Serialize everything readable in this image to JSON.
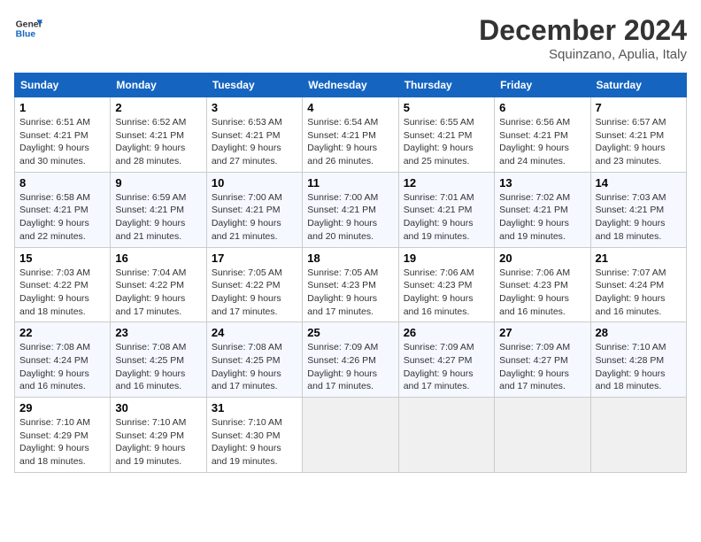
{
  "header": {
    "logo_line1": "General",
    "logo_line2": "Blue",
    "month": "December 2024",
    "location": "Squinzano, Apulia, Italy"
  },
  "weekdays": [
    "Sunday",
    "Monday",
    "Tuesday",
    "Wednesday",
    "Thursday",
    "Friday",
    "Saturday"
  ],
  "weeks": [
    [
      {
        "day": "1",
        "info": "Sunrise: 6:51 AM\nSunset: 4:21 PM\nDaylight: 9 hours and 30 minutes."
      },
      {
        "day": "2",
        "info": "Sunrise: 6:52 AM\nSunset: 4:21 PM\nDaylight: 9 hours and 28 minutes."
      },
      {
        "day": "3",
        "info": "Sunrise: 6:53 AM\nSunset: 4:21 PM\nDaylight: 9 hours and 27 minutes."
      },
      {
        "day": "4",
        "info": "Sunrise: 6:54 AM\nSunset: 4:21 PM\nDaylight: 9 hours and 26 minutes."
      },
      {
        "day": "5",
        "info": "Sunrise: 6:55 AM\nSunset: 4:21 PM\nDaylight: 9 hours and 25 minutes."
      },
      {
        "day": "6",
        "info": "Sunrise: 6:56 AM\nSunset: 4:21 PM\nDaylight: 9 hours and 24 minutes."
      },
      {
        "day": "7",
        "info": "Sunrise: 6:57 AM\nSunset: 4:21 PM\nDaylight: 9 hours and 23 minutes."
      }
    ],
    [
      {
        "day": "8",
        "info": "Sunrise: 6:58 AM\nSunset: 4:21 PM\nDaylight: 9 hours and 22 minutes."
      },
      {
        "day": "9",
        "info": "Sunrise: 6:59 AM\nSunset: 4:21 PM\nDaylight: 9 hours and 21 minutes."
      },
      {
        "day": "10",
        "info": "Sunrise: 7:00 AM\nSunset: 4:21 PM\nDaylight: 9 hours and 21 minutes."
      },
      {
        "day": "11",
        "info": "Sunrise: 7:00 AM\nSunset: 4:21 PM\nDaylight: 9 hours and 20 minutes."
      },
      {
        "day": "12",
        "info": "Sunrise: 7:01 AM\nSunset: 4:21 PM\nDaylight: 9 hours and 19 minutes."
      },
      {
        "day": "13",
        "info": "Sunrise: 7:02 AM\nSunset: 4:21 PM\nDaylight: 9 hours and 19 minutes."
      },
      {
        "day": "14",
        "info": "Sunrise: 7:03 AM\nSunset: 4:21 PM\nDaylight: 9 hours and 18 minutes."
      }
    ],
    [
      {
        "day": "15",
        "info": "Sunrise: 7:03 AM\nSunset: 4:22 PM\nDaylight: 9 hours and 18 minutes."
      },
      {
        "day": "16",
        "info": "Sunrise: 7:04 AM\nSunset: 4:22 PM\nDaylight: 9 hours and 17 minutes."
      },
      {
        "day": "17",
        "info": "Sunrise: 7:05 AM\nSunset: 4:22 PM\nDaylight: 9 hours and 17 minutes."
      },
      {
        "day": "18",
        "info": "Sunrise: 7:05 AM\nSunset: 4:23 PM\nDaylight: 9 hours and 17 minutes."
      },
      {
        "day": "19",
        "info": "Sunrise: 7:06 AM\nSunset: 4:23 PM\nDaylight: 9 hours and 16 minutes."
      },
      {
        "day": "20",
        "info": "Sunrise: 7:06 AM\nSunset: 4:23 PM\nDaylight: 9 hours and 16 minutes."
      },
      {
        "day": "21",
        "info": "Sunrise: 7:07 AM\nSunset: 4:24 PM\nDaylight: 9 hours and 16 minutes."
      }
    ],
    [
      {
        "day": "22",
        "info": "Sunrise: 7:08 AM\nSunset: 4:24 PM\nDaylight: 9 hours and 16 minutes."
      },
      {
        "day": "23",
        "info": "Sunrise: 7:08 AM\nSunset: 4:25 PM\nDaylight: 9 hours and 16 minutes."
      },
      {
        "day": "24",
        "info": "Sunrise: 7:08 AM\nSunset: 4:25 PM\nDaylight: 9 hours and 17 minutes."
      },
      {
        "day": "25",
        "info": "Sunrise: 7:09 AM\nSunset: 4:26 PM\nDaylight: 9 hours and 17 minutes."
      },
      {
        "day": "26",
        "info": "Sunrise: 7:09 AM\nSunset: 4:27 PM\nDaylight: 9 hours and 17 minutes."
      },
      {
        "day": "27",
        "info": "Sunrise: 7:09 AM\nSunset: 4:27 PM\nDaylight: 9 hours and 17 minutes."
      },
      {
        "day": "28",
        "info": "Sunrise: 7:10 AM\nSunset: 4:28 PM\nDaylight: 9 hours and 18 minutes."
      }
    ],
    [
      {
        "day": "29",
        "info": "Sunrise: 7:10 AM\nSunset: 4:29 PM\nDaylight: 9 hours and 18 minutes."
      },
      {
        "day": "30",
        "info": "Sunrise: 7:10 AM\nSunset: 4:29 PM\nDaylight: 9 hours and 19 minutes."
      },
      {
        "day": "31",
        "info": "Sunrise: 7:10 AM\nSunset: 4:30 PM\nDaylight: 9 hours and 19 minutes."
      },
      null,
      null,
      null,
      null
    ]
  ]
}
